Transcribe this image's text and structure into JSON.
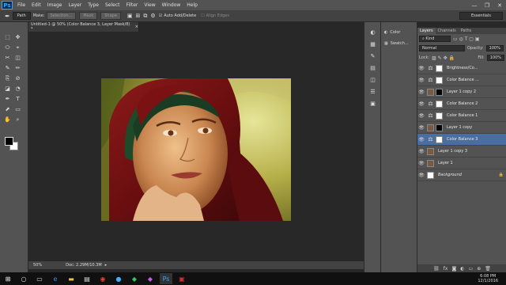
{
  "app": {
    "logo": "Ps"
  },
  "menu": [
    "File",
    "Edit",
    "Image",
    "Layer",
    "Type",
    "Select",
    "Filter",
    "View",
    "Window",
    "Help"
  ],
  "window_controls": [
    "—",
    "❐",
    "✕"
  ],
  "options": {
    "mode": "Path",
    "make_label": "Make:",
    "buttons": [
      "Selection...",
      "Mask",
      "Shape"
    ],
    "auto_add": "Auto Add/Delete",
    "align_edges": "Align Edges",
    "workspace": "Essentials"
  },
  "document": {
    "tab": "Untitled-1 @ 50% (Color Balance 3, Layer Mask/8) *",
    "zoom": "50%",
    "doc_info": "Doc: 2.29M/10.3M"
  },
  "side_panels": {
    "color": "Color",
    "swatches": "Swatch..."
  },
  "layers_panel": {
    "tabs": [
      "Layers",
      "Channels",
      "Paths"
    ],
    "kind": "Kind",
    "blend": "Normal",
    "opacity_label": "Opacity:",
    "opacity": "100%",
    "lock_label": "Lock:",
    "fill_label": "Fill:",
    "fill": "100%",
    "layers": [
      {
        "name": "Brightness/Co...",
        "type": "adj"
      },
      {
        "name": "Color Balance ...",
        "type": "adj"
      },
      {
        "name": "Layer 1 copy 2",
        "type": "photo_mask"
      },
      {
        "name": "Color Balance 2",
        "type": "adj"
      },
      {
        "name": "Color Balance 1",
        "type": "adj"
      },
      {
        "name": "Layer 1 copy",
        "type": "photo_mask"
      },
      {
        "name": "Color Balance 3",
        "type": "adj",
        "selected": true
      },
      {
        "name": "Layer 1 copy 3",
        "type": "photo"
      },
      {
        "name": "Layer 1",
        "type": "photo"
      },
      {
        "name": "Background",
        "type": "white"
      }
    ]
  },
  "taskbar": {
    "time": "6:08 PM",
    "date": "12/1/2016"
  },
  "colors": {
    "selected_layer": "#4b6ea2",
    "panel": "#535353",
    "canvas_bg": "#282828"
  }
}
